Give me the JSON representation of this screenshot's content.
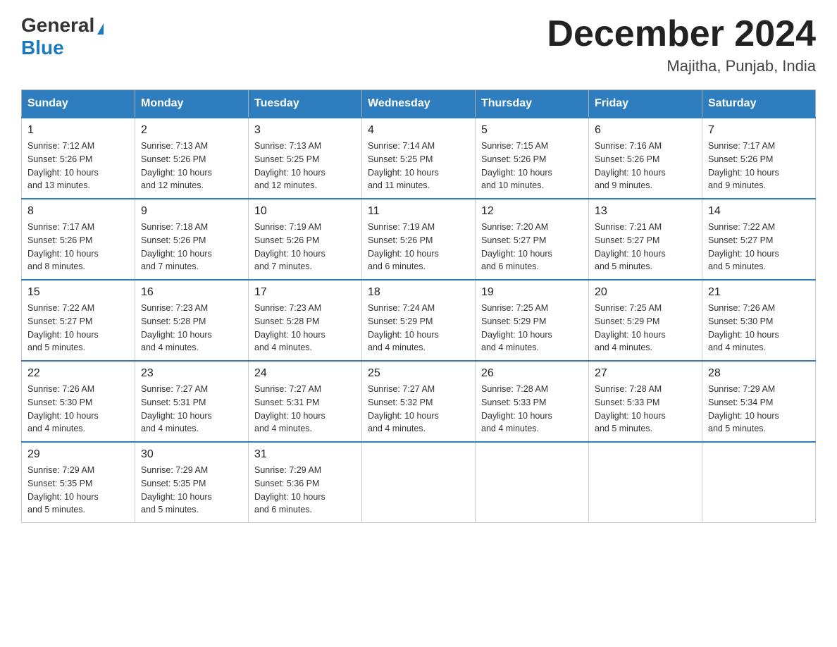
{
  "header": {
    "logo_general": "General",
    "logo_blue": "Blue",
    "month_title": "December 2024",
    "location": "Majitha, Punjab, India"
  },
  "days_of_week": [
    "Sunday",
    "Monday",
    "Tuesday",
    "Wednesday",
    "Thursday",
    "Friday",
    "Saturday"
  ],
  "weeks": [
    [
      {
        "day": "1",
        "sunrise": "7:12 AM",
        "sunset": "5:26 PM",
        "daylight": "10 hours and 13 minutes."
      },
      {
        "day": "2",
        "sunrise": "7:13 AM",
        "sunset": "5:26 PM",
        "daylight": "10 hours and 12 minutes."
      },
      {
        "day": "3",
        "sunrise": "7:13 AM",
        "sunset": "5:25 PM",
        "daylight": "10 hours and 12 minutes."
      },
      {
        "day": "4",
        "sunrise": "7:14 AM",
        "sunset": "5:25 PM",
        "daylight": "10 hours and 11 minutes."
      },
      {
        "day": "5",
        "sunrise": "7:15 AM",
        "sunset": "5:26 PM",
        "daylight": "10 hours and 10 minutes."
      },
      {
        "day": "6",
        "sunrise": "7:16 AM",
        "sunset": "5:26 PM",
        "daylight": "10 hours and 9 minutes."
      },
      {
        "day": "7",
        "sunrise": "7:17 AM",
        "sunset": "5:26 PM",
        "daylight": "10 hours and 9 minutes."
      }
    ],
    [
      {
        "day": "8",
        "sunrise": "7:17 AM",
        "sunset": "5:26 PM",
        "daylight": "10 hours and 8 minutes."
      },
      {
        "day": "9",
        "sunrise": "7:18 AM",
        "sunset": "5:26 PM",
        "daylight": "10 hours and 7 minutes."
      },
      {
        "day": "10",
        "sunrise": "7:19 AM",
        "sunset": "5:26 PM",
        "daylight": "10 hours and 7 minutes."
      },
      {
        "day": "11",
        "sunrise": "7:19 AM",
        "sunset": "5:26 PM",
        "daylight": "10 hours and 6 minutes."
      },
      {
        "day": "12",
        "sunrise": "7:20 AM",
        "sunset": "5:27 PM",
        "daylight": "10 hours and 6 minutes."
      },
      {
        "day": "13",
        "sunrise": "7:21 AM",
        "sunset": "5:27 PM",
        "daylight": "10 hours and 5 minutes."
      },
      {
        "day": "14",
        "sunrise": "7:22 AM",
        "sunset": "5:27 PM",
        "daylight": "10 hours and 5 minutes."
      }
    ],
    [
      {
        "day": "15",
        "sunrise": "7:22 AM",
        "sunset": "5:27 PM",
        "daylight": "10 hours and 5 minutes."
      },
      {
        "day": "16",
        "sunrise": "7:23 AM",
        "sunset": "5:28 PM",
        "daylight": "10 hours and 4 minutes."
      },
      {
        "day": "17",
        "sunrise": "7:23 AM",
        "sunset": "5:28 PM",
        "daylight": "10 hours and 4 minutes."
      },
      {
        "day": "18",
        "sunrise": "7:24 AM",
        "sunset": "5:29 PM",
        "daylight": "10 hours and 4 minutes."
      },
      {
        "day": "19",
        "sunrise": "7:25 AM",
        "sunset": "5:29 PM",
        "daylight": "10 hours and 4 minutes."
      },
      {
        "day": "20",
        "sunrise": "7:25 AM",
        "sunset": "5:29 PM",
        "daylight": "10 hours and 4 minutes."
      },
      {
        "day": "21",
        "sunrise": "7:26 AM",
        "sunset": "5:30 PM",
        "daylight": "10 hours and 4 minutes."
      }
    ],
    [
      {
        "day": "22",
        "sunrise": "7:26 AM",
        "sunset": "5:30 PM",
        "daylight": "10 hours and 4 minutes."
      },
      {
        "day": "23",
        "sunrise": "7:27 AM",
        "sunset": "5:31 PM",
        "daylight": "10 hours and 4 minutes."
      },
      {
        "day": "24",
        "sunrise": "7:27 AM",
        "sunset": "5:31 PM",
        "daylight": "10 hours and 4 minutes."
      },
      {
        "day": "25",
        "sunrise": "7:27 AM",
        "sunset": "5:32 PM",
        "daylight": "10 hours and 4 minutes."
      },
      {
        "day": "26",
        "sunrise": "7:28 AM",
        "sunset": "5:33 PM",
        "daylight": "10 hours and 4 minutes."
      },
      {
        "day": "27",
        "sunrise": "7:28 AM",
        "sunset": "5:33 PM",
        "daylight": "10 hours and 5 minutes."
      },
      {
        "day": "28",
        "sunrise": "7:29 AM",
        "sunset": "5:34 PM",
        "daylight": "10 hours and 5 minutes."
      }
    ],
    [
      {
        "day": "29",
        "sunrise": "7:29 AM",
        "sunset": "5:35 PM",
        "daylight": "10 hours and 5 minutes."
      },
      {
        "day": "30",
        "sunrise": "7:29 AM",
        "sunset": "5:35 PM",
        "daylight": "10 hours and 5 minutes."
      },
      {
        "day": "31",
        "sunrise": "7:29 AM",
        "sunset": "5:36 PM",
        "daylight": "10 hours and 6 minutes."
      },
      null,
      null,
      null,
      null
    ]
  ],
  "labels": {
    "sunrise": "Sunrise:",
    "sunset": "Sunset:",
    "daylight": "Daylight:"
  }
}
